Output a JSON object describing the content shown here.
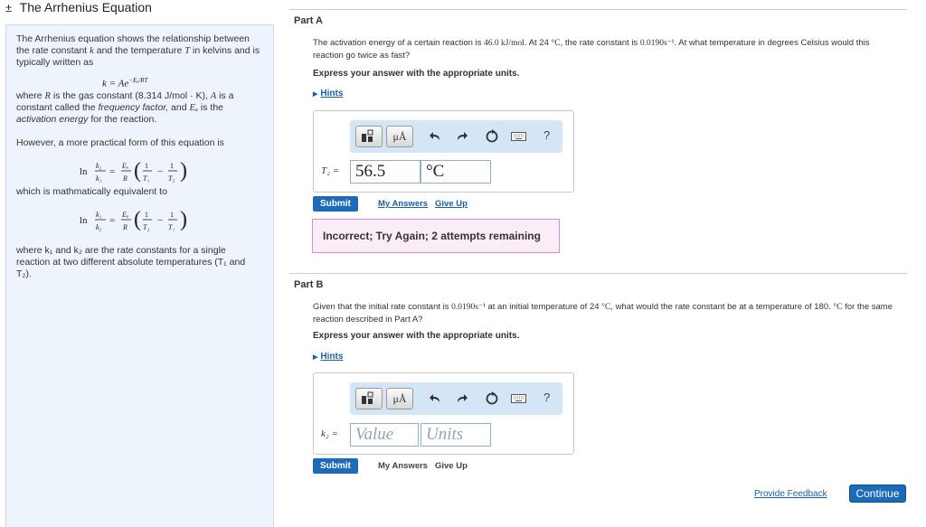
{
  "header": {
    "toggle": "±",
    "title": "The Arrhenius Equation"
  },
  "intro": {
    "text_a": "The Arrhenius equation shows the relationship between the rate constant",
    "var_k": "k",
    "text_b": "and the temperature",
    "var_T": "T",
    "text_c": "in kelvins and is typically written as",
    "eq_main_lhs": "k = Ae",
    "eq_main_exp": "−Eₐ/RT",
    "where_a": "where",
    "var_R": "R",
    "where_b": "is the gas constant (8.314 J/mol · K),",
    "var_A": "A",
    "where_c": "is a constant called the",
    "frequency_factor": "frequency factor,",
    "where_d": "and",
    "var_Ea": "Eₐ",
    "where_e": "is the",
    "activation_energy": "activation energy",
    "where_f": "for the reaction.",
    "however": "However, a more practical form of this equation is",
    "eq1_left": "ln",
    "eq1_frac_num": "k₂",
    "eq1_frac_den": "k₁",
    "eq_eq": "=",
    "eq_ea": "Eₐ",
    "eq_R": "R",
    "eq1_t1": "T₁",
    "eq1_t2": "T₂",
    "one": "1",
    "minus": "−",
    "equiv": "which is mathmatically equivalent to",
    "eq2_frac_num": "k₁",
    "eq2_frac_den": "k₂",
    "eq2_t1": "T₂",
    "eq2_t2": "T₁",
    "where_bottom": "where k₁ and k₂ are the rate constants for a single reaction at two different absolute temperatures (T₁ and T₂)."
  },
  "partA": {
    "title": "Part A",
    "q1": "The activation energy of a certain reaction is",
    "q_ea": "46.0 kJ/mol",
    "q2": ". At 24",
    "q_deg": "°C",
    "q3": ", the rate constant is",
    "q_k": "0.0190s⁻¹",
    "q4": ". At what temperature in degrees Celsius would this reaction go twice as fast?",
    "express": "Express your answer with the appropriate units.",
    "hints": "Hints",
    "var_label": "T₂ =",
    "value": "56.5",
    "units": "°C",
    "submit": "Submit",
    "my_answers": "My Answers",
    "give_up": "Give Up",
    "feedback": "Incorrect; Try Again; 2 attempts remaining"
  },
  "partB": {
    "title": "Part B",
    "q1": "Given that the initial rate constant is",
    "q_k": "0.0190s⁻¹",
    "q2": "at an initial temperature of 24",
    "q_deg": "°C",
    "q3": ", what would the rate constant be at a temperature of 180.",
    "q4": "°C",
    "q5": "for the same reaction described in Part A?",
    "express": "Express your answer with the appropriate units.",
    "hints": "Hints",
    "var_label": "k₂ =",
    "value_placeholder": "Value",
    "units_placeholder": "Units",
    "submit": "Submit",
    "my_answers": "My Answers",
    "give_up": "Give Up"
  },
  "toolbar": {
    "units_label": "μÅ",
    "help": "?"
  },
  "footer": {
    "provide_feedback": "Provide Feedback",
    "continue": "Continue"
  },
  "colors": {
    "accent": "#1d6bb8",
    "panel_bg": "#eef4fb",
    "toolbar_bg": "#d4e5f6",
    "error_bg": "#fbedf7"
  },
  "icons": [
    "templates-icon",
    "units-icon",
    "undo-icon",
    "redo-icon",
    "reset-icon",
    "keyboard-icon",
    "help-icon"
  ]
}
